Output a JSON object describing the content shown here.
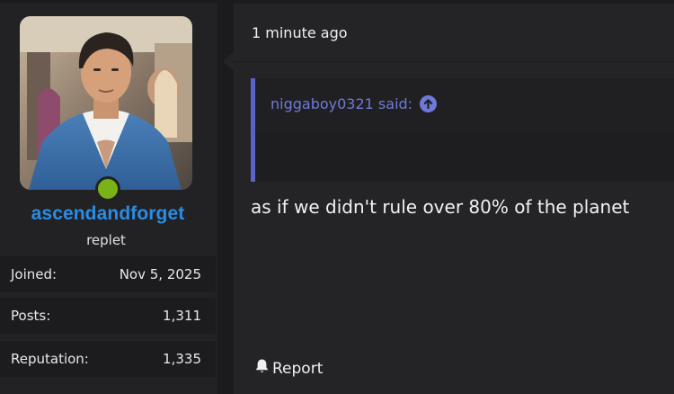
{
  "post": {
    "timestamp": "1 minute ago",
    "quote": {
      "author_said": "niggaboy0321 said:",
      "icon": "arrow-up-circle-icon"
    },
    "message": "as if we didn't rule over 80% of the planet",
    "actions": {
      "report_label": "Report",
      "report_icon": "bell-icon"
    }
  },
  "user": {
    "username": "ascendandforget",
    "title": "replet",
    "online_status_color": "#7ab317",
    "stats": [
      {
        "label": "Joined:",
        "value": "Nov 5, 2025"
      },
      {
        "label": "Posts:",
        "value": "1,311"
      },
      {
        "label": "Reputation:",
        "value": "1,335"
      }
    ]
  },
  "colors": {
    "username": "#2b8ce6",
    "quote_accent": "#5b63c8",
    "quote_author": "#6f79d8"
  }
}
